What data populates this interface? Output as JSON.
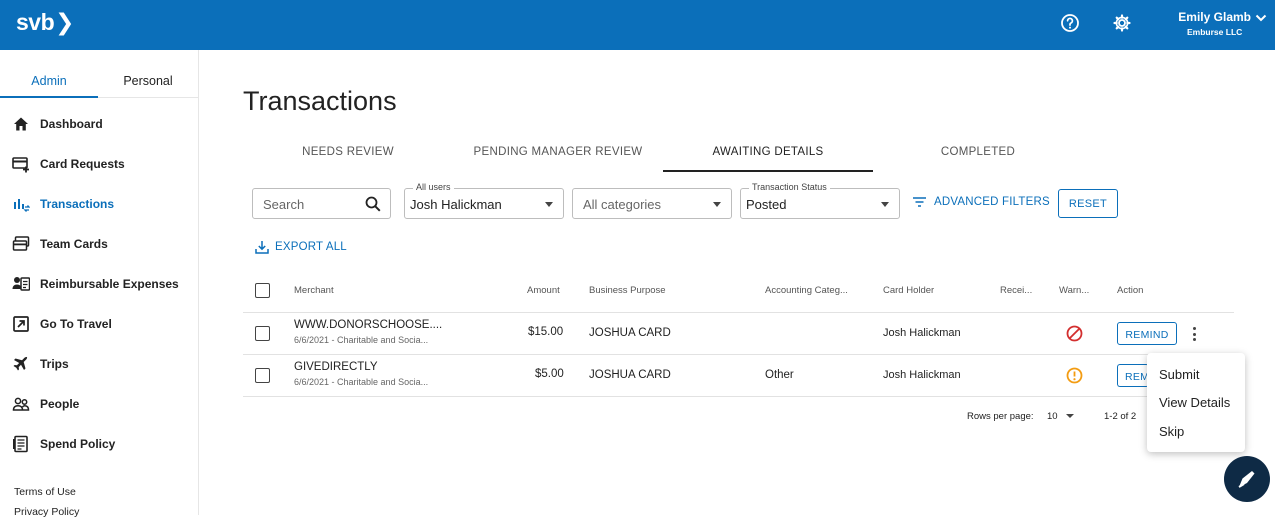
{
  "header": {
    "logo": "svb",
    "user_name": "Emily Glamb",
    "user_org": "Emburse LLC"
  },
  "sidebar": {
    "tabs": [
      "Admin",
      "Personal"
    ],
    "items": [
      {
        "label": "Dashboard",
        "icon": "home-icon"
      },
      {
        "label": "Card Requests",
        "icon": "card-add-icon"
      },
      {
        "label": "Transactions",
        "icon": "transactions-icon"
      },
      {
        "label": "Team Cards",
        "icon": "cards-icon"
      },
      {
        "label": "Reimbursable Expenses",
        "icon": "reimburse-icon"
      },
      {
        "label": "Go To Travel",
        "icon": "external-link-icon"
      },
      {
        "label": "Trips",
        "icon": "plane-icon"
      },
      {
        "label": "People",
        "icon": "people-icon"
      },
      {
        "label": "Spend Policy",
        "icon": "policy-icon"
      }
    ],
    "footer_links": [
      "Terms of Use",
      "Privacy Policy"
    ]
  },
  "main": {
    "title": "Transactions",
    "tabs": [
      "NEEDS REVIEW",
      "PENDING MANAGER REVIEW",
      "AWAITING DETAILS",
      "COMPLETED"
    ],
    "active_tab": "AWAITING DETAILS",
    "filters": {
      "search_placeholder": "Search",
      "users_label": "All users",
      "users_value": "Josh Halickman",
      "categories_value": "All categories",
      "status_label": "Transaction Status",
      "status_value": "Posted",
      "advanced_filters": "ADVANCED FILTERS",
      "reset": "RESET"
    },
    "export_all": "EXPORT ALL",
    "columns": [
      "Merchant",
      "Amount",
      "Business Purpose",
      "Accounting Categ...",
      "Card Holder",
      "Recei...",
      "Warn...",
      "Action"
    ],
    "rows": [
      {
        "merchant": "WWW.DONORSCHOOSE....",
        "date_cat": "6/6/2021 - Charitable and Socia...",
        "amount": "$15.00",
        "purpose": "JOSHUA CARD",
        "category": "",
        "holder": "Josh Halickman",
        "warning": "blocked",
        "action": "REMIND"
      },
      {
        "merchant": "GIVEDIRECTLY",
        "date_cat": "6/6/2021 - Charitable and Socia...",
        "amount": "$5.00",
        "purpose": "JOSHUA CARD",
        "category": "Other",
        "holder": "Josh Halickman",
        "warning": "alert",
        "action": "REMIND"
      }
    ],
    "pagination": {
      "rows_label": "Rows per page:",
      "rows_value": "10",
      "range": "1-2 of 2"
    },
    "context_menu": [
      "Submit",
      "View Details",
      "Skip"
    ]
  },
  "colors": {
    "brand": "#0b6fba",
    "error": "#d32f2f",
    "warning": "#f39c12",
    "fab": "#0e2a45"
  }
}
